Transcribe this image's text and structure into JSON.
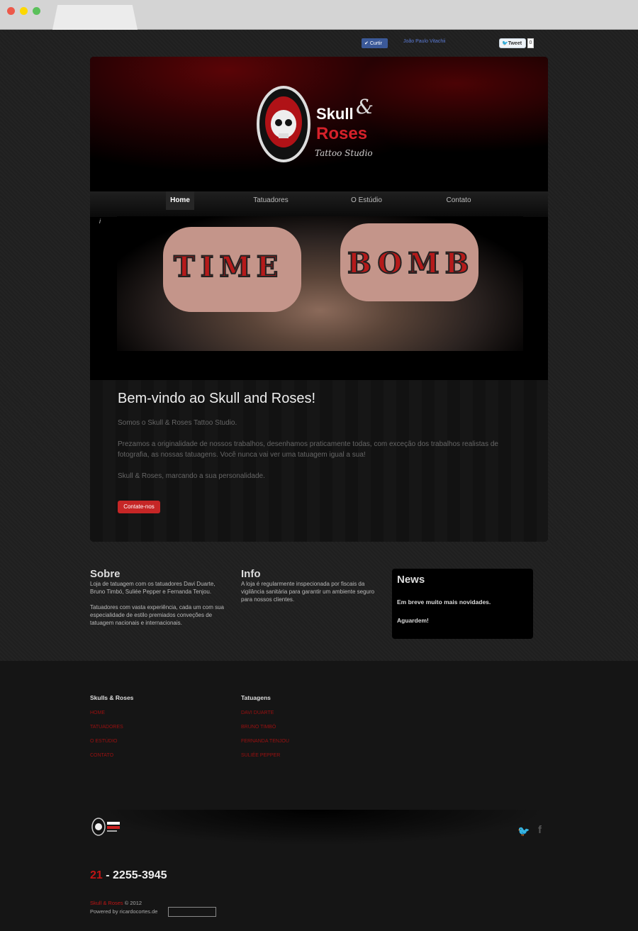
{
  "social": {
    "like_label": "Curtir",
    "user_name": "João Paulo Vitachii",
    "tweet_label": "Tweet",
    "tweet_count": "0"
  },
  "logo": {
    "text1": "Skull",
    "amp": "&",
    "text2": "Roses",
    "sub": "Tattoo Studio"
  },
  "nav": {
    "items": [
      "Home",
      "Tatuadores",
      "O Estúdio",
      "Contato"
    ]
  },
  "slide": {
    "info": "i",
    "words": [
      "TIME",
      "BOMB"
    ]
  },
  "welcome": {
    "title": "Bem-vindo ao Skull and Roses!",
    "p1": "Somos o Skull & Roses Tattoo Studio.",
    "p2": "Prezamos a originalidade de nossos trabalhos, desenhamos praticamente todas, com exceção dos trabalhos realistas de fotografia, as nossas tatuagens. Você nunca vai ver uma tatuagem igual a sua!",
    "p3": "Skull & Roses, marcando a sua personalidade.",
    "button": "Contate-nos"
  },
  "sobre": {
    "title": "Sobre",
    "p1": "Loja de tatuagem com os tatuadores Davi Duarte, Bruno Timbó, Suliée Pepper e Fernanda Tenjou.",
    "p2": "Tatuadores com vasta experiência, cada um com sua especialidade de estilo premiados conveções de tatuagem nacionais e internacionais."
  },
  "info": {
    "title": "Info",
    "p1": "A loja é regularmente inspecionada por fiscais da vigilância sanitária para garantir um ambiente seguro para nossos clientes."
  },
  "news": {
    "title": "News",
    "p1": "Em breve muito mais novidades.",
    "p2": "Aguardem!"
  },
  "footer": {
    "col1": {
      "title": "Skulls & Roses",
      "links": [
        "HOME",
        "TATUADORES",
        "O ESTÚDIO",
        "CONTATO"
      ]
    },
    "col2": {
      "title": "Tatuagens",
      "links": [
        "DAVI DUARTE",
        "BRUNO TIMBÓ",
        "FERNANDA TENJOU",
        "SULIÉE PEPPER"
      ]
    },
    "phone_area": "21",
    "phone_rest": "- 2255-3945",
    "copy_link": "Skull & Roses",
    "copy_year": "© 2012",
    "powered": "Powered by ricardocortes.de"
  }
}
